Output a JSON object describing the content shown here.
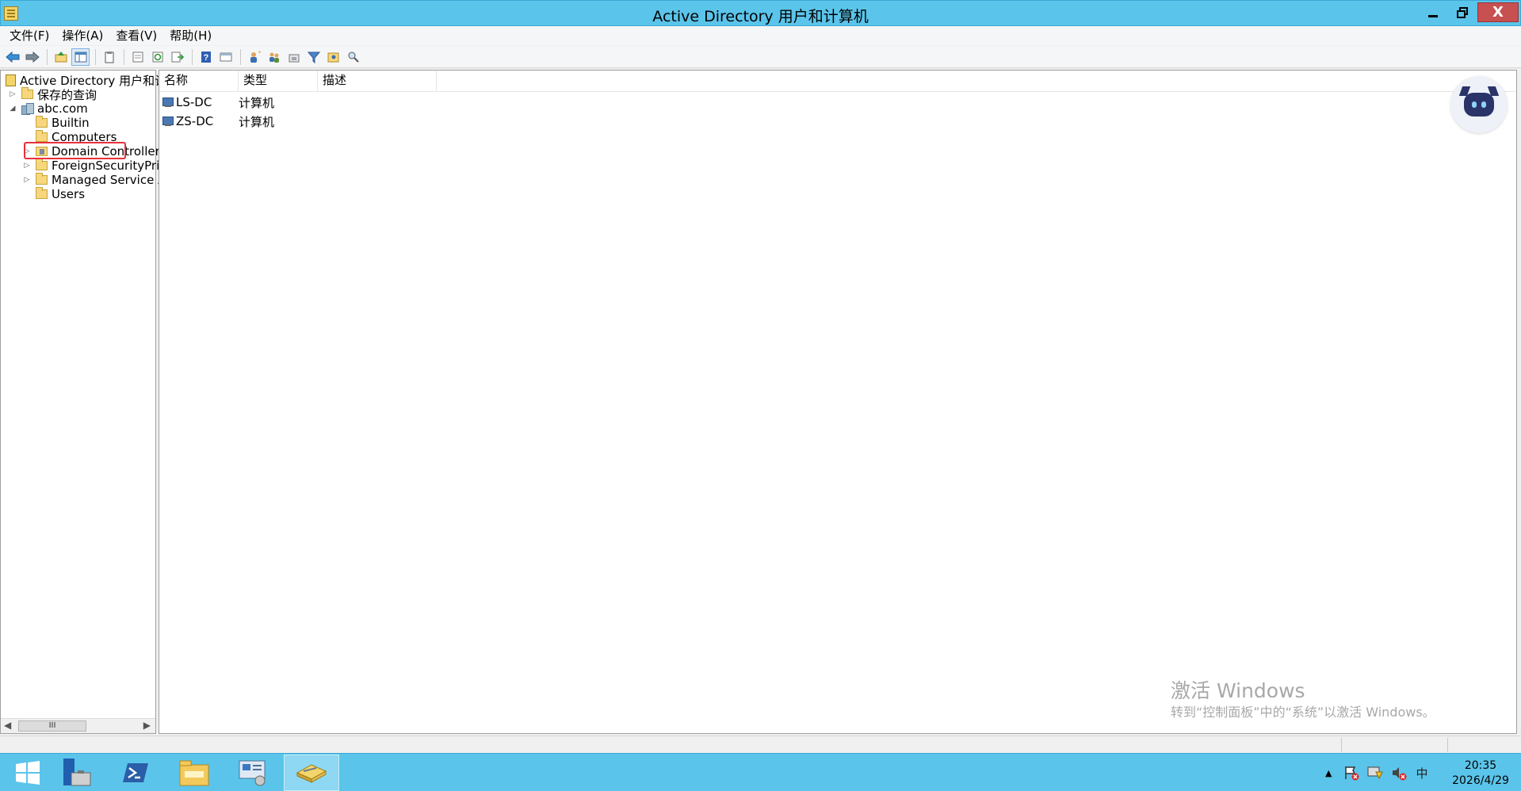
{
  "window": {
    "title": "Active Directory 用户和计算机",
    "minimize_glyph": "▁",
    "maximize_glyph": "❐",
    "close_glyph": "X"
  },
  "menu": {
    "items": [
      "文件(F)",
      "操作(A)",
      "查看(V)",
      "帮助(H)"
    ]
  },
  "toolbar": {
    "icons": [
      "back-icon",
      "forward-icon",
      "up-folder-icon",
      "show-hide-tree-icon",
      "copy-icon",
      "properties-icon",
      "refresh-icon",
      "export-list-icon",
      "help-icon",
      "mmc-icon",
      "new-user-icon",
      "new-group-icon",
      "new-ou-icon",
      "filter-icon",
      "add-to-group-icon",
      "find-icon"
    ]
  },
  "tree": {
    "root": "Active Directory 用户和计算机",
    "saved_queries": "保存的查询",
    "domain": "abc.com",
    "children": [
      "Builtin",
      "Computers",
      "Domain Controllers",
      "ForeignSecurityPrincipals",
      "Managed Service Accounts",
      "Users"
    ],
    "selected": "Computers",
    "scroll_thumb": "III"
  },
  "list": {
    "columns": [
      "名称",
      "类型",
      "描述"
    ],
    "rows": [
      {
        "name": "LS-DC",
        "type": "计算机",
        "description": ""
      },
      {
        "name": "ZS-DC",
        "type": "计算机",
        "description": ""
      }
    ]
  },
  "watermark": {
    "title": "激活 Windows",
    "subtitle": "转到“控制面板”中的“系统”以激活 Windows。"
  },
  "taskbar": {
    "apps": [
      "start-icon",
      "server-manager-icon",
      "powershell-icon",
      "file-explorer-icon",
      "control-panel-icon",
      "ad-users-computers-icon"
    ],
    "ime": "中",
    "time": "20:35",
    "date": "2026/4/29"
  }
}
